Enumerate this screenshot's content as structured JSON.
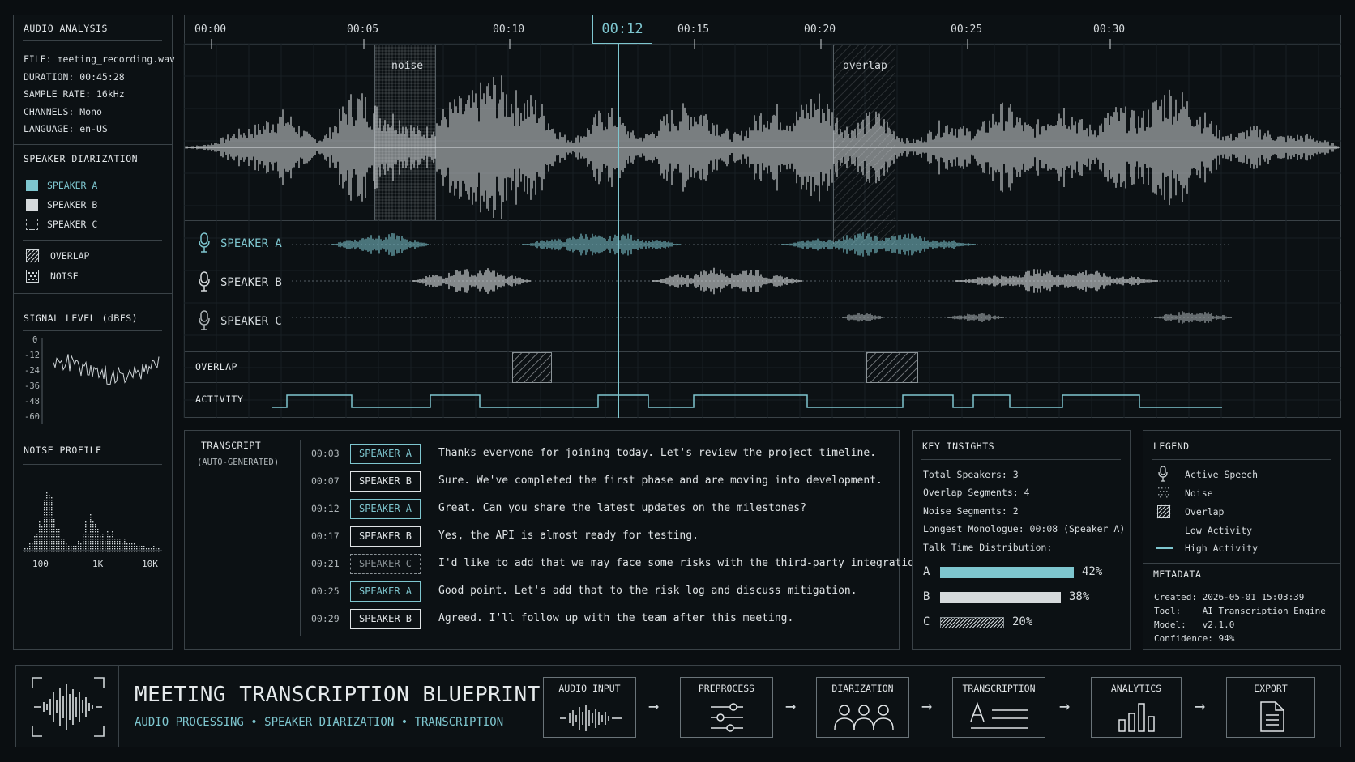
{
  "audio": {
    "title": "AUDIO ANALYSIS",
    "file": "FILE: meeting_recording.wav",
    "duration": "DURATION: 00:45:28",
    "sample_rate": "SAMPLE RATE: 16kHz",
    "channels": "CHANNELS: Mono",
    "language": "LANGUAGE: en-US"
  },
  "diarization": {
    "title": "SPEAKER DIARIZATION",
    "speaker_a": "SPEAKER A",
    "speaker_b": "SPEAKER B",
    "speaker_c": "SPEAKER C",
    "overlap": "OVERLAP",
    "noise": "NOISE"
  },
  "signal": {
    "title": "SIGNAL LEVEL (dBFS)",
    "ticks": [
      "0",
      "-12",
      "-24",
      "-36",
      "-48",
      "-60"
    ]
  },
  "noise_profile": {
    "title": "NOISE PROFILE",
    "ticks": [
      "100",
      "1K",
      "10K"
    ]
  },
  "timeline": {
    "ticks": [
      "00:00",
      "00:05",
      "00:10",
      "00:15",
      "00:20",
      "00:25",
      "00:30"
    ],
    "current": "00:12",
    "noise_label": "noise",
    "overlap_label": "overlap",
    "track_a": "SPEAKER A",
    "track_b": "SPEAKER B",
    "track_c": "SPEAKER C",
    "overlap_row": "OVERLAP",
    "activity_row": "ACTIVITY"
  },
  "transcript": {
    "title": "TRANSCRIPT",
    "subtitle": "(AUTO-GENERATED)",
    "rows": [
      {
        "time": "00:03",
        "speaker": "SPEAKER A",
        "kind": "a",
        "text": "Thanks everyone for joining today. Let's review the project timeline."
      },
      {
        "time": "00:07",
        "speaker": "SPEAKER B",
        "kind": "b",
        "text": "Sure. We've completed the first phase and are moving into development."
      },
      {
        "time": "00:12",
        "speaker": "SPEAKER A",
        "kind": "a",
        "text": "Great. Can you share the latest updates on the milestones?"
      },
      {
        "time": "00:17",
        "speaker": "SPEAKER B",
        "kind": "b",
        "text": "Yes, the API is almost ready for testing."
      },
      {
        "time": "00:21",
        "speaker": "SPEAKER C",
        "kind": "c",
        "text": "I'd like to add that we may face some risks with the third-party integration."
      },
      {
        "time": "00:25",
        "speaker": "SPEAKER A",
        "kind": "a",
        "text": "Good point. Let's add that to the risk log and discuss mitigation."
      },
      {
        "time": "00:29",
        "speaker": "SPEAKER B",
        "kind": "b",
        "text": "Agreed. I'll follow up with the team after this meeting."
      }
    ]
  },
  "insights": {
    "title": "KEY INSIGHTS",
    "total": "Total Speakers: 3",
    "overlap": "Overlap Segments: 4",
    "noise": "Noise Segments: 2",
    "longest": "Longest Monologue: 00:08 (Speaker A)",
    "talk": "Talk Time Distribution:",
    "bars": [
      {
        "label": "A",
        "pct": "42%",
        "value": 42
      },
      {
        "label": "B",
        "pct": "38%",
        "value": 38
      },
      {
        "label": "C",
        "pct": "20%",
        "value": 20
      }
    ]
  },
  "legend": {
    "title": "LEGEND",
    "active": "Active Speech",
    "noise": "Noise",
    "overlap": "Overlap",
    "low": "Low Activity",
    "high": "High Activity"
  },
  "metadata": {
    "title": "METADATA",
    "created": "Created: 2026-05-01 15:03:39",
    "tool": "Tool:    AI Transcription Engine",
    "model": "Model:   v2.1.0",
    "confidence": "Confidence: 94%"
  },
  "footer": {
    "title": "MEETING TRANSCRIPTION BLUEPRINT",
    "subtitle": "AUDIO PROCESSING • SPEAKER DIARIZATION • TRANSCRIPTION",
    "steps": [
      "AUDIO INPUT",
      "PREPROCESS",
      "DIARIZATION",
      "TRANSCRIPTION",
      "ANALYTICS",
      "EXPORT"
    ]
  },
  "colors": {
    "accent": "#7ec6cf",
    "bg": "#0a0e11",
    "line": "#3a4247"
  }
}
